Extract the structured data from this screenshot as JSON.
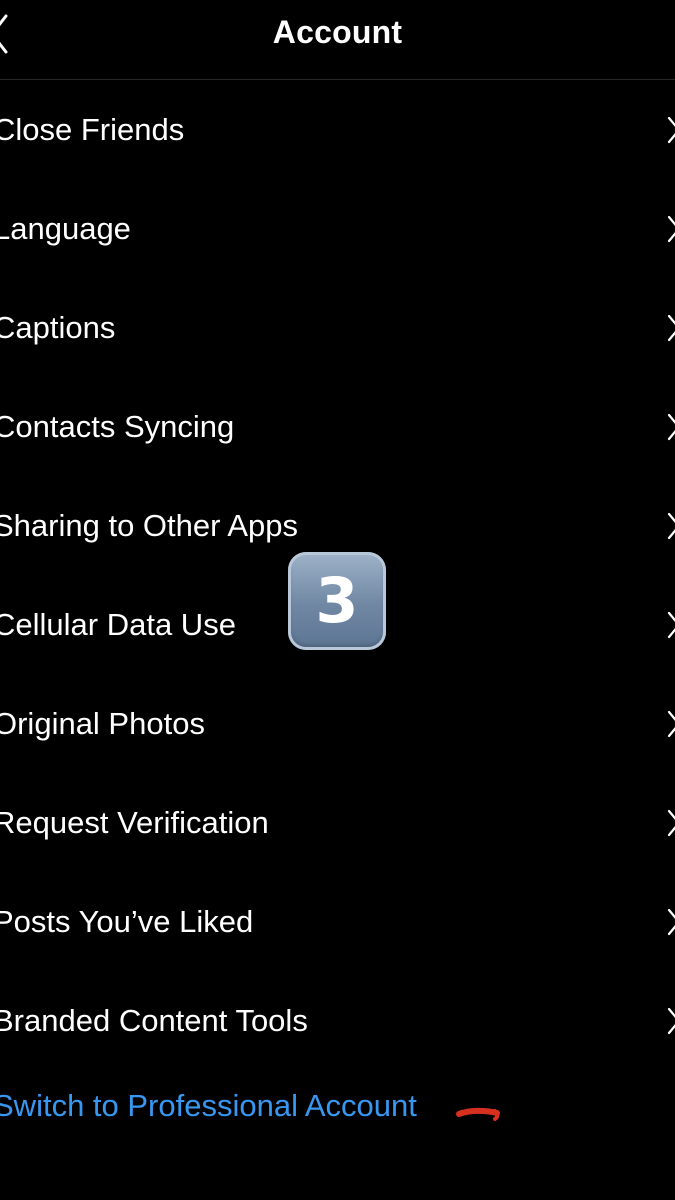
{
  "header": {
    "title": "Account"
  },
  "menu": {
    "items": [
      {
        "label": "Close Friends"
      },
      {
        "label": "Language"
      },
      {
        "label": "Captions"
      },
      {
        "label": "Contacts Syncing"
      },
      {
        "label": "Sharing to Other Apps"
      },
      {
        "label": "Cellular Data Use"
      },
      {
        "label": "Original Photos"
      },
      {
        "label": "Request Verification"
      },
      {
        "label": "Posts You’ve Liked"
      },
      {
        "label": "Branded Content Tools"
      }
    ],
    "switch_account_label": "Switch to Professional Account"
  },
  "overlay": {
    "step_badge": "3"
  },
  "icons": {
    "back": "chevron-left-icon",
    "row_chevron": "chevron-right-icon",
    "annotation": "red-underline-mark"
  },
  "colors": {
    "background": "#000000",
    "text": "#ffffff",
    "link_blue": "#3897f0",
    "chevron": "#ffffff",
    "divider": "#262626",
    "annotation_red": "#d8301f"
  }
}
